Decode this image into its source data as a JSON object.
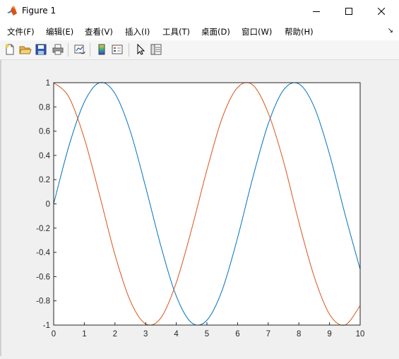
{
  "window": {
    "title": "Figure 1",
    "controls": {
      "minimize": "minimize",
      "maximize": "maximize",
      "close": "close"
    }
  },
  "menu": {
    "items": [
      {
        "label": "文件(F)"
      },
      {
        "label": "编辑(E)"
      },
      {
        "label": "查看(V)"
      },
      {
        "label": "插入(I)"
      },
      {
        "label": "工具(T)"
      },
      {
        "label": "桌面(D)"
      },
      {
        "label": "窗口(W)"
      },
      {
        "label": "帮助(H)"
      }
    ],
    "corner_glyph": "↘"
  },
  "toolbar": {
    "buttons": [
      "new-figure-icon",
      "open-file-icon",
      "save-icon",
      "print-icon",
      "link-plot-icon",
      "colorbar-icon",
      "legend-icon",
      "pointer-icon",
      "property-inspector-icon"
    ]
  },
  "chart_data": {
    "type": "line",
    "title": "",
    "xlabel": "",
    "ylabel": "",
    "xlim": [
      0,
      10
    ],
    "ylim": [
      -1,
      1
    ],
    "xticks": [
      "0",
      "1",
      "2",
      "3",
      "4",
      "5",
      "6",
      "7",
      "8",
      "9",
      "10"
    ],
    "yticks": [
      "1",
      "0.8",
      "0.6",
      "0.4",
      "0.2",
      "0",
      "-0.2",
      "-0.4",
      "-0.6",
      "-0.8",
      "-1"
    ],
    "grid": false,
    "legend": "none",
    "series": [
      {
        "color": "#0072bd",
        "x": [
          0,
          0.5,
          1,
          1.5,
          2,
          2.5,
          3,
          3.5,
          4,
          4.5,
          5,
          5.5,
          6,
          6.5,
          7,
          7.5,
          8,
          8.5,
          9,
          9.5,
          10
        ],
        "y": [
          0,
          0.48,
          0.84,
          1.0,
          0.91,
          0.6,
          0.14,
          -0.35,
          -0.76,
          -0.98,
          -0.96,
          -0.71,
          -0.28,
          0.22,
          0.66,
          0.94,
          0.99,
          0.8,
          0.41,
          -0.08,
          -0.54
        ]
      },
      {
        "color": "#d95319",
        "x": [
          0,
          0.5,
          1,
          1.5,
          2,
          2.5,
          3,
          3.5,
          4,
          4.5,
          5,
          5.5,
          6,
          6.5,
          7,
          7.5,
          8,
          8.5,
          9,
          9.5,
          10
        ],
        "y": [
          1.0,
          0.88,
          0.54,
          0.07,
          -0.42,
          -0.8,
          -0.99,
          -0.94,
          -0.65,
          -0.21,
          0.28,
          0.71,
          0.96,
          0.98,
          0.75,
          0.35,
          -0.15,
          -0.6,
          -0.91,
          -1.0,
          -0.84
        ]
      }
    ]
  }
}
